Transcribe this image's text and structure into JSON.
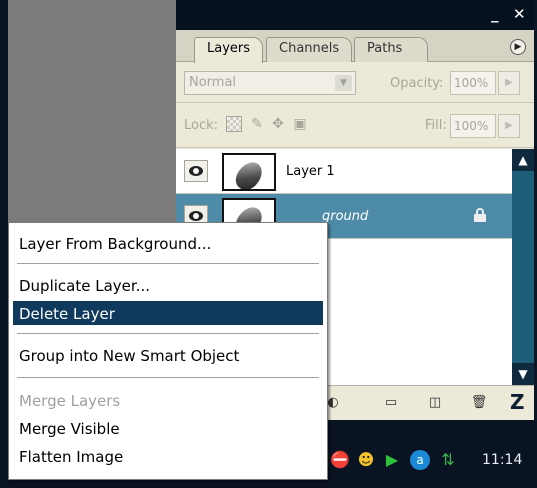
{
  "panel": {
    "tabs": [
      {
        "label": "Layers",
        "active": true
      },
      {
        "label": "Channels",
        "active": false
      },
      {
        "label": "Paths",
        "active": false
      }
    ],
    "blend_mode": "Normal",
    "opacity_label": "Opacity:",
    "opacity_value": "100%",
    "lock_label": "Lock:",
    "fill_label": "Fill:",
    "fill_value": "100%",
    "layers": [
      {
        "name": "Layer 1",
        "visible": true,
        "selected": false,
        "locked": false
      },
      {
        "name": "Background",
        "visible_text": "ground",
        "visible": true,
        "selected": true,
        "locked": true
      }
    ],
    "bottom_icons": [
      "adjustment-layer-icon",
      "new-group-icon",
      "new-layer-icon",
      "trash-icon"
    ]
  },
  "context_menu": {
    "items": [
      {
        "label": "Layer From Background...",
        "state": "normal"
      },
      {
        "label": "Duplicate Layer...",
        "state": "normal"
      },
      {
        "label": "Delete Layer",
        "state": "highlighted"
      },
      {
        "label": "Group into New Smart Object",
        "state": "normal"
      },
      {
        "label": "Merge Layers",
        "state": "disabled"
      },
      {
        "label": "Merge Visible",
        "state": "normal"
      },
      {
        "label": "Flatten Image",
        "state": "normal"
      }
    ]
  },
  "taskbar": {
    "clock": "11:14"
  },
  "colors": {
    "selection": "#0f3a5e",
    "selected_layer": "#4e8ba8",
    "panel_bg": "#ece9d8"
  }
}
